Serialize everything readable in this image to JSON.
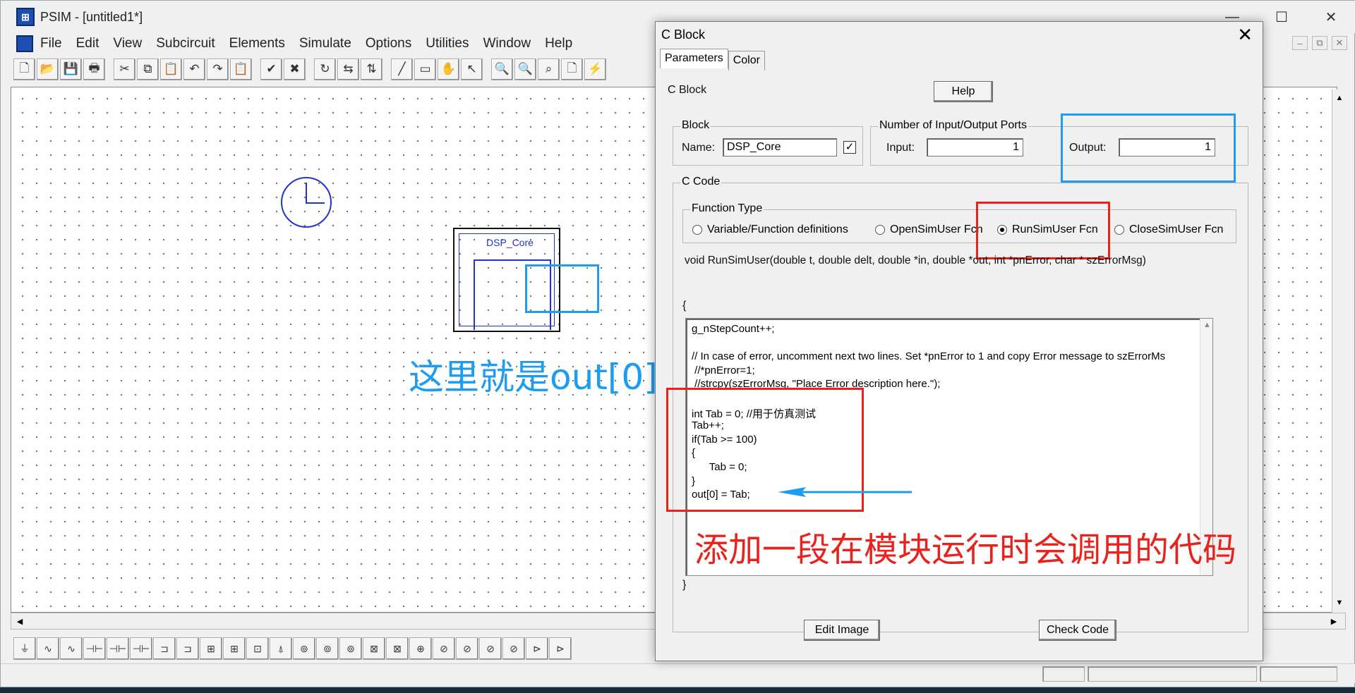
{
  "window": {
    "title": "PSIM - [untitled1*]",
    "min": "—",
    "max": "☐",
    "close": "✕"
  },
  "menu": [
    "File",
    "Edit",
    "View",
    "Subcircuit",
    "Elements",
    "Simulate",
    "Options",
    "Utilities",
    "Window",
    "Help"
  ],
  "toolbar_icons": [
    "new-icon",
    "open-icon",
    "save-icon",
    "print-icon",
    "cut-icon",
    "copy-icon",
    "paste-icon",
    "undo-icon",
    "redo-icon",
    "clipboard-icon",
    "run-check-icon",
    "stop-icon",
    "rotate-icon",
    "flip-x-icon",
    "flip-y-icon",
    "wire-icon",
    "label-icon",
    "pan-hand-icon",
    "select-arrow-icon",
    "zoom-in-icon",
    "zoom-out-icon",
    "zoom-fit-icon",
    "page-icon",
    "simulate-icon"
  ],
  "toolbar_glyphs": [
    "🗋",
    "📂",
    "💾",
    "🖶",
    "✂",
    "⧉",
    "📋",
    "↶",
    "↷",
    "📋",
    "✔",
    "✖",
    "↻",
    "⇆",
    "⇅",
    "╱",
    "▭",
    "✋",
    "↖",
    "🔍",
    "🔍",
    "⌕",
    "🗋",
    "⚡"
  ],
  "element_glyphs": [
    "⏚",
    "∿",
    "∿",
    "⊣⊢",
    "⊣⊢",
    "⊣⊢",
    "⊐",
    "⊐",
    "⊞",
    "⊞",
    "⊡",
    "⍋",
    "⊚",
    "⊚",
    "⊚",
    "⊠",
    "⊠",
    "⊕",
    "⊘",
    "⊘",
    "⊘",
    "⊘",
    "⊳",
    "⊳"
  ],
  "schematic": {
    "block_label": "DSP_Core"
  },
  "annotations": {
    "blue_text": "这里就是out[0]",
    "red_text": "添加一段在模块运行时会调用的代码"
  },
  "dialog": {
    "title": "C Block",
    "close": "✕",
    "tabs": [
      "Parameters",
      "Color"
    ],
    "section_label": "C Block",
    "help_button": "Help",
    "block_group": "Block",
    "name_label": "Name:",
    "name_value": "DSP_Core",
    "name_checked": "✓",
    "ports_group": "Number of Input/Output Ports",
    "input_label": "Input:",
    "input_value": "1",
    "output_label": "Output:",
    "output_value": "1",
    "ccode_group": "C Code",
    "function_type_group": "Function Type",
    "function_types": [
      "Variable/Function definitions",
      "OpenSimUser Fcn",
      "RunSimUser Fcn",
      "CloseSimUser Fcn"
    ],
    "selected_function": 2,
    "signature": "void RunSimUser(double t, double delt, double *in, double *out, int *pnError, char * szErrorMsg)",
    "open_brace": "{",
    "close_brace": "}",
    "code_lines": [
      "g_nStepCount++;",
      "",
      "// In case of error, uncomment next two lines. Set *pnError to 1 and copy Error message to szErrorMs",
      " //*pnError=1;",
      " //strcpy(szErrorMsg, \"Place Error description here.\");",
      "",
      "int Tab = 0; //用于仿真测试",
      "Tab++;",
      "if(Tab >= 100)",
      "{",
      "      Tab = 0;",
      "}",
      "out[0] = Tab;"
    ],
    "edit_image_button": "Edit Image",
    "check_code_button": "Check Code"
  },
  "colors": {
    "annotation_blue": "#1e9cf0",
    "annotation_red": "#e8231e",
    "schematic_blue": "#2233cc"
  }
}
